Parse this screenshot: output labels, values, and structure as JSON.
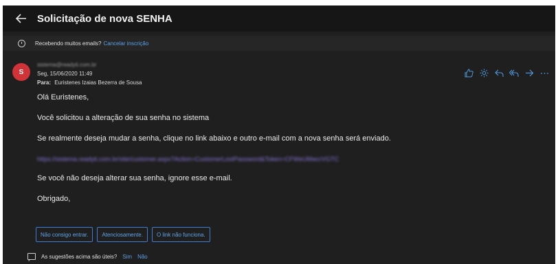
{
  "header": {
    "title": "Solicitação de nova SENHA"
  },
  "infobar": {
    "text": "Recebendo muitos emails?",
    "unsubscribe": "Cancelar inscrição"
  },
  "message": {
    "avatar_letter": "S",
    "sender": "sistema@readyti.com.br",
    "date": "Seg, 15/06/2020 11:49",
    "to_label": "Para:",
    "to_name": "Euristenes Izaias Bezerra de Sousa",
    "actions": [
      "like-icon",
      "sun-icon",
      "reply-icon",
      "reply-all-icon",
      "forward-icon",
      "more-icon"
    ]
  },
  "body": {
    "greeting": "Olá Euristenes,",
    "line1": "Você solicitou a alteração de sua senha no sistema",
    "line2": "Se realmente deseja mudar a senha, clique no link abaixo e outro e-mail com a nova senha será enviado.",
    "link": "https://sistema.readyti.com.br/site/customer.aspx?Action=CustomerLostPassword&Token=CFWeUMwcrVGTC",
    "line3": "Se você não deseja alterar sua senha, ignore esse e-mail.",
    "closing": "Obrigado,"
  },
  "suggestions": {
    "items": [
      "Não consigo entrar.",
      "Atenciosamente.",
      "O link não funciona."
    ]
  },
  "feedback": {
    "question": "As sugestões acima são úteis?",
    "yes": "Sim",
    "no": "Não"
  }
}
